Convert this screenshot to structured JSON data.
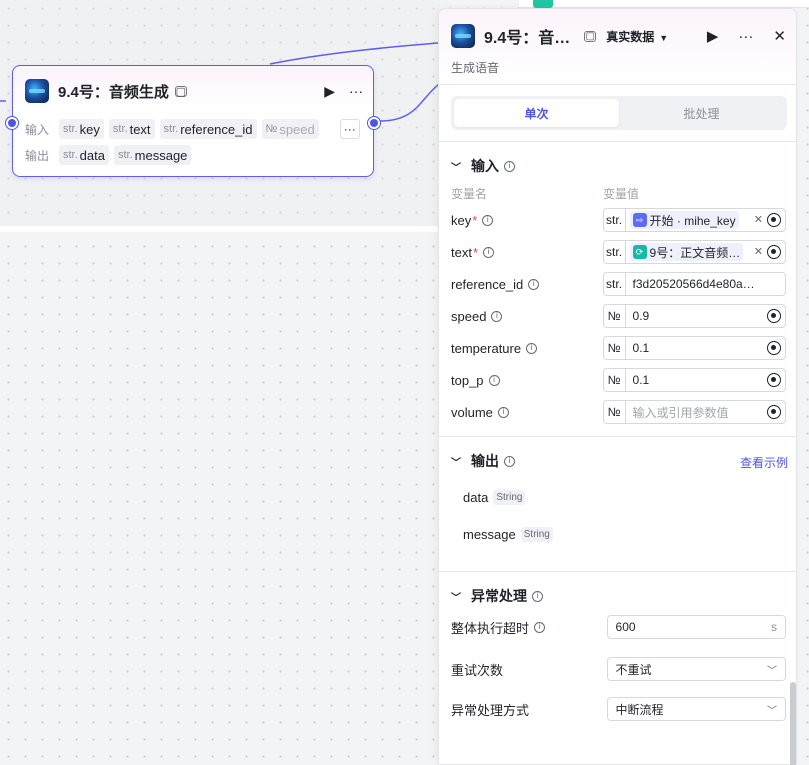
{
  "node": {
    "title": "9.4号：音频生成",
    "input_label": "输入",
    "output_label": "输出",
    "inputs": [
      {
        "type": "str.",
        "name": "key"
      },
      {
        "type": "str.",
        "name": "text"
      },
      {
        "type": "str.",
        "name": "reference_id"
      },
      {
        "type": "№",
        "name": "speed"
      }
    ],
    "more": "···",
    "outputs": [
      {
        "type": "str.",
        "name": "data"
      },
      {
        "type": "str.",
        "name": "message"
      }
    ]
  },
  "panel": {
    "title": "9.4号：音…",
    "data_mode": "真实数据",
    "subtitle": "生成语音",
    "tabs": [
      "单次",
      "批处理"
    ],
    "input_section": "输入",
    "col_name": "变量名",
    "col_value": "变量值",
    "params": [
      {
        "name": "key",
        "required": true,
        "type": "str.",
        "chip": true,
        "chip_icon": "start-icon",
        "chip_text": "开始 · mihe_key"
      },
      {
        "name": "text",
        "required": true,
        "type": "str.",
        "chip": true,
        "chip_icon": "loop-icon",
        "chip_text": "9号：正文音频…"
      },
      {
        "name": "reference_id",
        "required": false,
        "type": "str.",
        "value": "f3d20520566d4e80a…"
      },
      {
        "name": "speed",
        "required": false,
        "type": "№",
        "value": "0.9"
      },
      {
        "name": "temperature",
        "required": false,
        "type": "№",
        "value": "0.1"
      },
      {
        "name": "top_p",
        "required": false,
        "type": "№",
        "value": "0.1"
      },
      {
        "name": "volume",
        "required": false,
        "type": "№",
        "placeholder": "输入或引用参数值"
      }
    ],
    "output_section": "输出",
    "view_example": "查看示例",
    "outputs": [
      {
        "name": "data",
        "type": "String"
      },
      {
        "name": "message",
        "type": "String"
      }
    ],
    "exception_section": "异常处理",
    "timeout_label": "整体执行超时",
    "timeout_value": "600",
    "timeout_unit": "s",
    "retry_label": "重试次数",
    "retry_value": "不重试",
    "handling_label": "异常处理方式",
    "handling_value": "中断流程"
  },
  "colors": {
    "accent": "#4e54e8",
    "teal": "#18b9a8",
    "required": "#e5484d"
  }
}
